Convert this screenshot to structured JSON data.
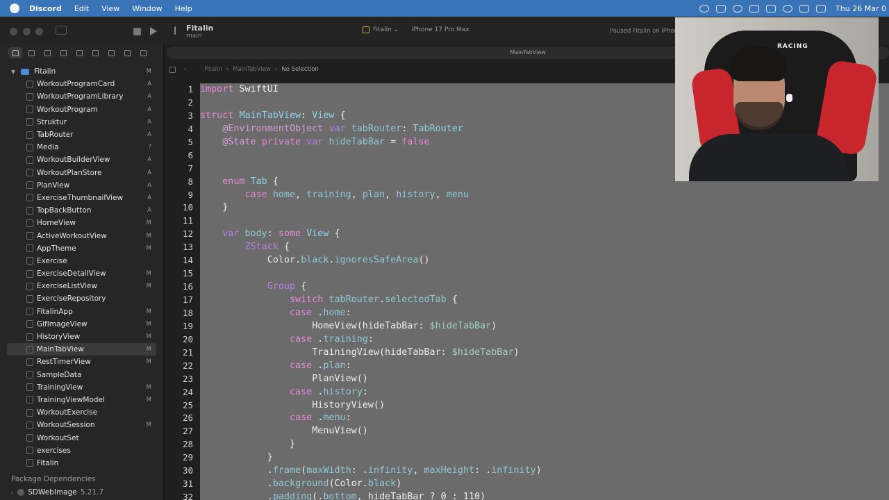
{
  "menubar": {
    "app": "Discord",
    "items": [
      "Edit",
      "View",
      "Window",
      "Help"
    ],
    "clock": "Thu 26 Mar 0"
  },
  "titlebar": {
    "project": "Fitalin",
    "branch": "main",
    "scheme": "Fitalin",
    "device": "iPhone 17 Pro Max",
    "status": "Paused Fitalin on iPhone"
  },
  "navigator": {
    "root": {
      "label": "Fitalin",
      "status": "M"
    },
    "files": [
      {
        "label": "WorkoutProgramCard",
        "status": "A"
      },
      {
        "label": "WorkoutProgramLibrary",
        "status": "A"
      },
      {
        "label": "WorkoutProgram",
        "status": "A"
      },
      {
        "label": "Struktur",
        "status": "A"
      },
      {
        "label": "TabRouter",
        "status": "A"
      },
      {
        "label": "Media",
        "status": "?"
      },
      {
        "label": "WorkoutBuilderView",
        "status": "A"
      },
      {
        "label": "WorkoutPlanStore",
        "status": "A"
      },
      {
        "label": "PlanView",
        "status": "A"
      },
      {
        "label": "ExerciseThumbnailView",
        "status": "A"
      },
      {
        "label": "TopBackButton",
        "status": "A"
      },
      {
        "label": "HomeView",
        "status": "M"
      },
      {
        "label": "ActiveWorkoutView",
        "status": "M"
      },
      {
        "label": "AppTheme",
        "status": "M"
      },
      {
        "label": "Exercise",
        "status": ""
      },
      {
        "label": "ExerciseDetailView",
        "status": "M"
      },
      {
        "label": "ExerciseListView",
        "status": "M"
      },
      {
        "label": "ExerciseRepository",
        "status": ""
      },
      {
        "label": "FitalinApp",
        "status": "M"
      },
      {
        "label": "GifImageView",
        "status": "M"
      },
      {
        "label": "HistoryView",
        "status": "M"
      },
      {
        "label": "MainTabView",
        "status": "M"
      },
      {
        "label": "RestTimerView",
        "status": "M"
      },
      {
        "label": "SampleData",
        "status": ""
      },
      {
        "label": "TrainingView",
        "status": "M"
      },
      {
        "label": "TrainingViewModel",
        "status": "M"
      },
      {
        "label": "WorkoutExercise",
        "status": ""
      },
      {
        "label": "WorkoutSession",
        "status": "M"
      },
      {
        "label": "WorkoutSet",
        "status": ""
      },
      {
        "label": "exercises",
        "status": ""
      },
      {
        "label": "Fitalin",
        "status": ""
      }
    ],
    "selected_index": 21,
    "package_header": "Package Dependencies",
    "packages": [
      {
        "name": "SDWebImage",
        "version": "5.21.7"
      }
    ]
  },
  "editor": {
    "tab": "MainTabView",
    "breadcrumb": [
      "Fitalin",
      "MainTabView",
      "No Selection"
    ],
    "first_line": 1,
    "lines": [
      "<span class=\"kw\">import</span> SwiftUI",
      "",
      "<span class=\"kw\">struct</span> <span class=\"ty\">MainTabView</span>: <span class=\"ty\">View</span> {",
      "    <span class=\"at\">@EnvironmentObject</span> <span class=\"kw2\">var</span> <span class=\"pr\">tabRouter</span>: <span class=\"ty\">TabRouter</span>",
      "    <span class=\"at\">@State</span> <span class=\"kw\">private</span> <span class=\"kw2\">var</span> <span class=\"pr\">hideTabBar</span> = <span class=\"kw\">false</span>",
      "",
      "",
      "    <span class=\"kw\">enum</span> <span class=\"ty\">Tab</span> {",
      "        <span class=\"kw\">case</span> <span class=\"pr\">home</span>, <span class=\"pr\">training</span>, <span class=\"pr\">plan</span>, <span class=\"pr\">history</span>, <span class=\"pr\">menu</span>",
      "    }",
      "",
      "    <span class=\"kw2\">var</span> <span class=\"pr\">body</span>: <span class=\"kw\">some</span> <span class=\"ty\">View</span> {",
      "        <span class=\"kw2\">ZStack</span> {",
      "            Color.<span class=\"dot\">black</span>.<span class=\"dot\">ignoresSafeArea</span>()",
      "",
      "            <span class=\"kw2\">Group</span> {",
      "                <span class=\"kw\">switch</span> <span class=\"pr\">tabRouter</span>.<span class=\"pr\">selectedTab</span> {",
      "                <span class=\"kw\">case</span> .<span class=\"pr\">home</span>:",
      "                    HomeView(hideTabBar: <span class=\"bind\">$hideTabBar</span>)",
      "                <span class=\"kw\">case</span> .<span class=\"pr\">training</span>:",
      "                    TrainingView(hideTabBar: <span class=\"bind\">$hideTabBar</span>)",
      "                <span class=\"kw\">case</span> .<span class=\"pr\">plan</span>:",
      "                    PlanView()",
      "                <span class=\"kw\">case</span> .<span class=\"pr\">history</span>:",
      "                    HistoryView()",
      "                <span class=\"kw\">case</span> .<span class=\"pr\">menu</span>:",
      "                    MenuView()",
      "                }",
      "            }",
      "            .<span class=\"dot\">frame</span>(<span class=\"dot\">maxWidth</span>: .<span class=\"dot\">infinity</span>, <span class=\"dot\">maxHeight</span>: .<span class=\"dot\">infinity</span>)",
      "            .<span class=\"dot\">background</span>(Color.<span class=\"dot\">black</span>)",
      "            .<span class=\"dot\">padding</span>(.<span class=\"dot\">bottom</span>, hideTabBar ? 0 : 110)"
    ]
  },
  "webcam": {
    "chair_logo": "RACING"
  }
}
